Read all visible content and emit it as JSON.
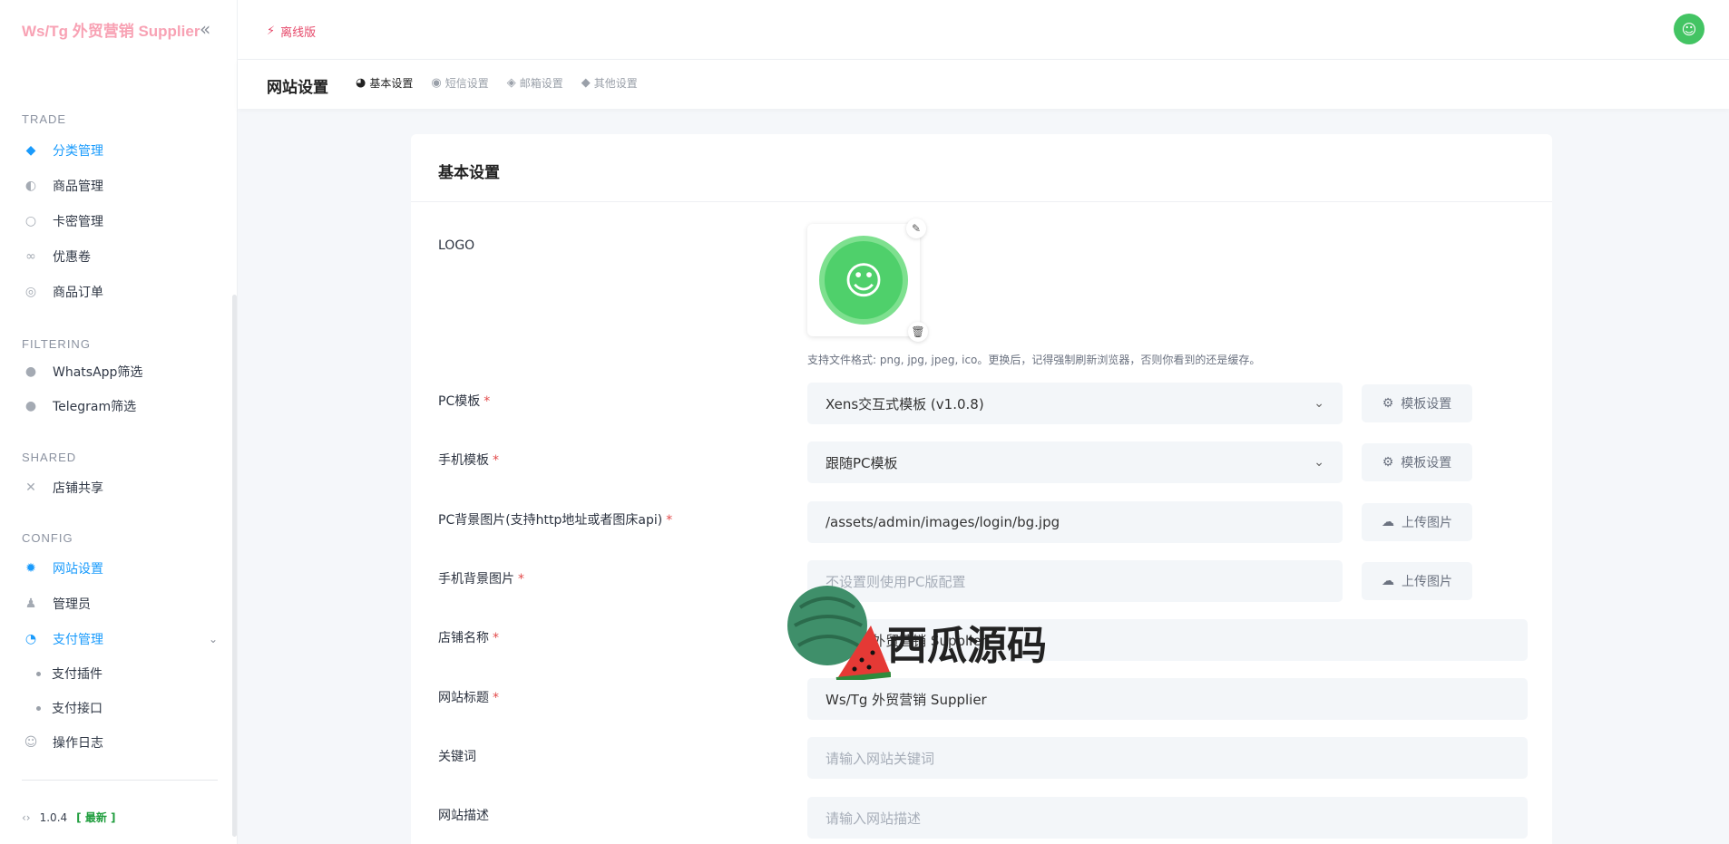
{
  "brand": "Ws/Tg 外贸营销 Supplier",
  "topbar": {
    "offline_label": "离线版"
  },
  "sidebar": {
    "sections": {
      "trade": "TRADE",
      "filtering": "FILTERING",
      "shared": "SHARED",
      "config": "CONFIG"
    },
    "items": {
      "category": "分类管理",
      "product": "商品管理",
      "card_key": "卡密管理",
      "coupon": "优惠卷",
      "order": "商品订单",
      "whatsapp": "WhatsApp筛选",
      "telegram": "Telegram筛选",
      "shop_share": "店铺共享",
      "site_settings": "网站设置",
      "admin": "管理员",
      "payment": "支付管理",
      "payment_plugin": "支付插件",
      "payment_api": "支付接口",
      "operation_log": "操作日志"
    },
    "version": "1.0.4",
    "version_badge": "[ 最新 ]"
  },
  "subheader": {
    "title": "网站设置",
    "tabs": [
      "基本设置",
      "短信设置",
      "邮箱设置",
      "其他设置"
    ]
  },
  "card": {
    "title": "基本设置",
    "logo_label": "LOGO",
    "logo_hint": "支持文件格式: png, jpg, jpeg, ico。更换后，记得强制刷新浏览器，否则你看到的还是缓存。",
    "fields": {
      "pc_template": {
        "label": "PC模板",
        "value": "Xens交互式模板 (v1.0.8)",
        "button": "模板设置"
      },
      "mobile_template": {
        "label": "手机模板",
        "value": "跟随PC模板",
        "button": "模板设置"
      },
      "pc_bg": {
        "label": "PC背景图片(支持http地址或者图床api)",
        "value": "/assets/admin/images/login/bg.jpg",
        "button": "上传图片"
      },
      "mobile_bg": {
        "label": "手机背景图片",
        "placeholder": "不设置则使用PC版配置",
        "button": "上传图片"
      },
      "shop_name": {
        "label": "店铺名称",
        "value": "Ws/Tg 外贸营销 Supplier"
      },
      "site_title": {
        "label": "网站标题",
        "value": "Ws/Tg 外贸营销 Supplier"
      },
      "keywords": {
        "label": "关键词",
        "placeholder": "请输入网站关键词"
      },
      "description": {
        "label": "网站描述",
        "placeholder": "请输入网站描述"
      }
    }
  },
  "watermark": "西瓜源码",
  "colors": {
    "accent": "#1a9bfc",
    "brand": "#f8a2b4",
    "required": "#e34b4b",
    "logo_green": "#4fd06b"
  }
}
